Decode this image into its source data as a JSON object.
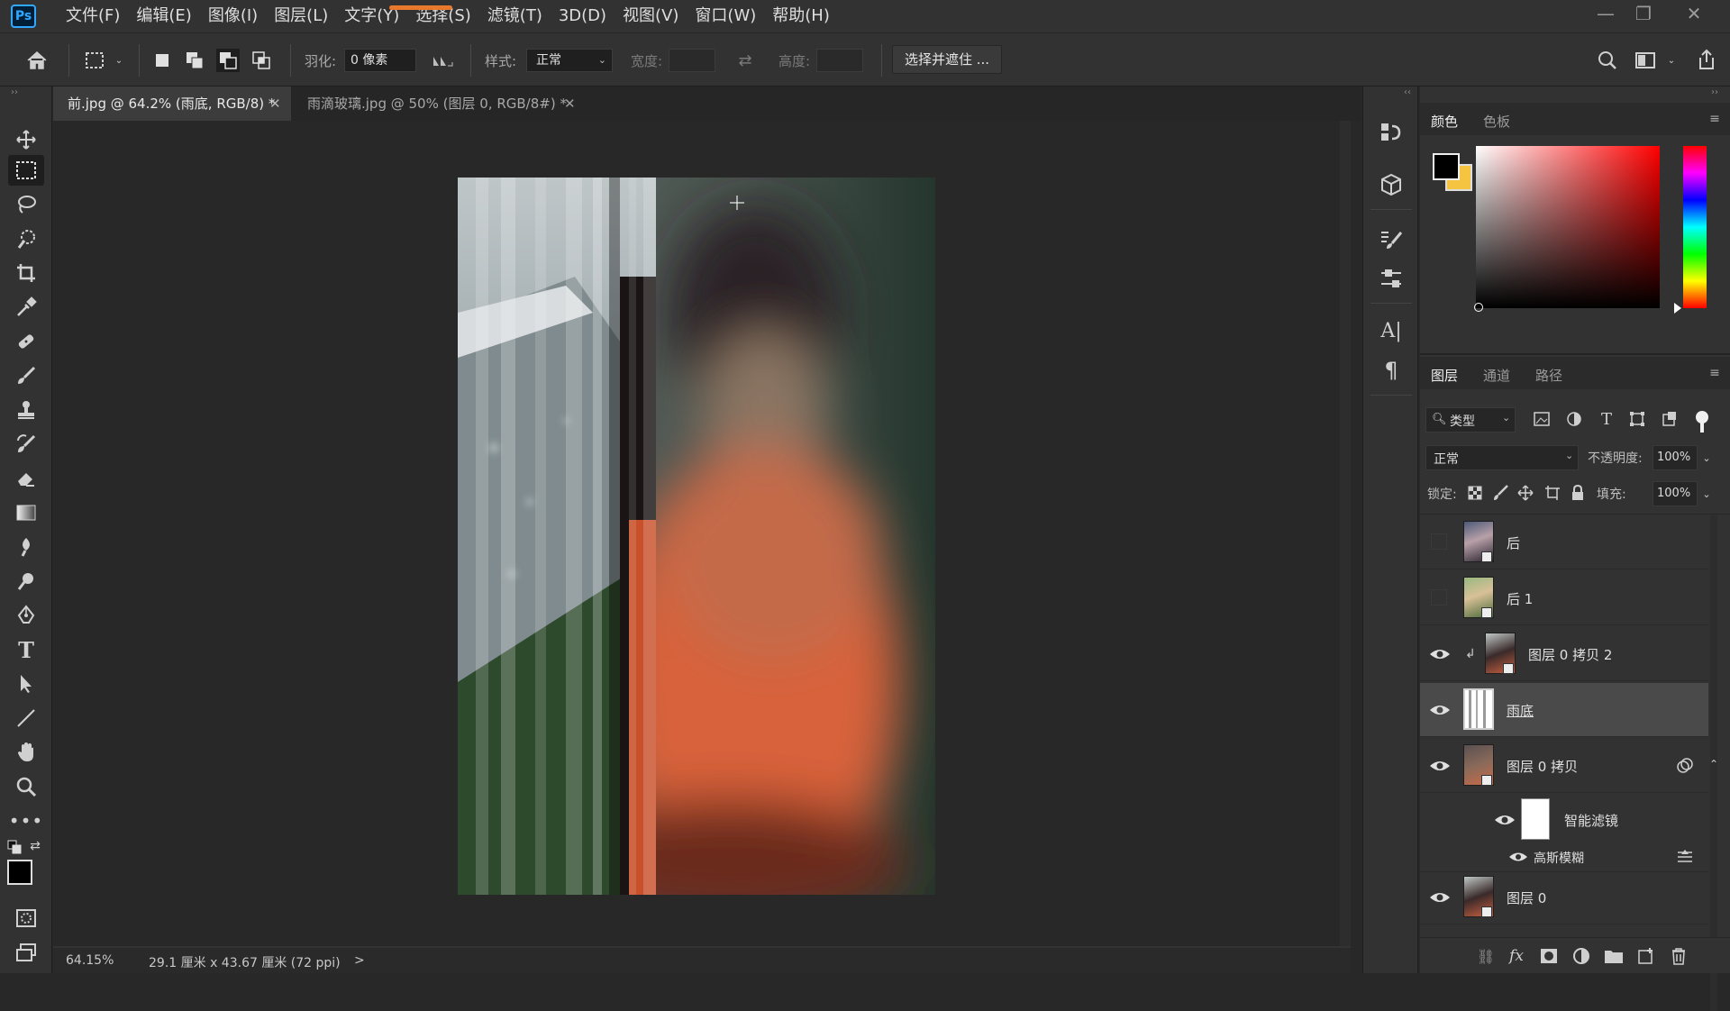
{
  "app": {
    "logo": "Ps"
  },
  "menu": [
    "文件(F)",
    "编辑(E)",
    "图像(I)",
    "图层(L)",
    "文字(Y)",
    "选择(S)",
    "滤镜(T)",
    "3D(D)",
    "视图(V)",
    "窗口(W)",
    "帮助(H)"
  ],
  "options": {
    "feather_label": "羽化:",
    "feather_value": "0 像素",
    "style_label": "样式:",
    "style_value": "正常",
    "width_label": "宽度:",
    "height_label": "高度:",
    "select_mask_button": "选择并遮住 ..."
  },
  "tabs": [
    {
      "label": "前.jpg @ 64.2% (雨底, RGB/8) *",
      "active": true
    },
    {
      "label": "雨滴玻璃.jpg @ 50% (图层 0, RGB/8#) *",
      "active": false
    }
  ],
  "status": {
    "zoom": "64.15%",
    "doc_size": "29.1 厘米 x 43.67 厘米 (72 ppi)",
    "arrow": ">"
  },
  "color_panel": {
    "tabs": [
      "颜色",
      "色板"
    ],
    "fg": "#000000",
    "bg": "#f5c542"
  },
  "layers_panel": {
    "tabs": [
      "图层",
      "通道",
      "路径"
    ],
    "filter_kind": "类型",
    "blend_mode": "正常",
    "opacity_label": "不透明度:",
    "opacity_value": "100%",
    "lock_label": "锁定:",
    "fill_label": "填充:",
    "fill_value": "100%",
    "layers": [
      {
        "name": "后",
        "visible": false,
        "selected": false
      },
      {
        "name": "后 1",
        "visible": false,
        "selected": false
      },
      {
        "name": "图层 0 拷贝 2",
        "visible": true,
        "selected": false,
        "clipped": true
      },
      {
        "name": "雨底",
        "visible": true,
        "selected": true
      },
      {
        "name": "图层 0 拷贝",
        "visible": true,
        "selected": false
      },
      {
        "name": "智能滤镜",
        "visible": true,
        "selected": false
      },
      {
        "name": "高斯模糊",
        "visible": true,
        "selected": false
      },
      {
        "name": "图层 0",
        "visible": true,
        "selected": false
      }
    ]
  }
}
